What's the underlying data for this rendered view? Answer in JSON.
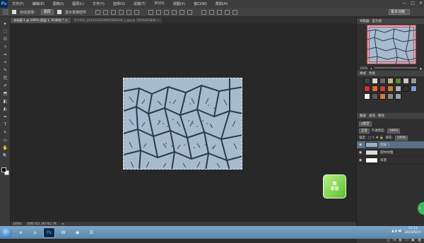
{
  "app": {
    "logo": "Ps"
  },
  "menu": [
    "文件(F)",
    "编辑(E)",
    "图像(I)",
    "图层(L)",
    "文字(Y)",
    "选择(S)",
    "滤镜(T)",
    "3D(D)",
    "视图(V)",
    "窗口(W)",
    "帮助(H)"
  ],
  "window_controls": {
    "min": "—",
    "max": "□",
    "close": "✕"
  },
  "options": {
    "auto_select_label": "自动选择：",
    "auto_select_value": "图层",
    "transform_label": "显示变换控件",
    "workspace": "基本功能"
  },
  "tabs": [
    {
      "label": "未标题-1 @ 100% (图层 1, RGB/8) *",
      "close": "×"
    },
    {
      "label": "551553_2014101024945084200_1.jpg @ 100%(RGB/8)",
      "close": "×"
    }
  ],
  "status": {
    "zoom": "100%",
    "doc": "文档:452.2K/702.7K",
    "arrow": "▸"
  },
  "panels": {
    "navigator_tabs": [
      "导航器",
      "直方图"
    ],
    "nav_zoom": "100%",
    "styles_tabs": [
      "样式",
      "色板"
    ],
    "layers_tabs": [
      "图层",
      "通道",
      "路径"
    ],
    "kind_label": "ρ类型",
    "blend_mode": "正常",
    "opacity_label": "不透明度:",
    "opacity_value": "100%",
    "lock_label": "锁定:",
    "fill_label": "填充:",
    "fill_value": "100%",
    "layers": [
      {
        "name": "图层 1",
        "selected": true
      },
      {
        "name": "裂纹纹理",
        "selected": false
      },
      {
        "name": "背景",
        "selected": false
      }
    ],
    "footer_icons": [
      "ⓖ",
      "fx",
      "◐",
      "▭",
      "▣",
      "🗑"
    ]
  },
  "float_logo": {
    "line1": "简",
    "line2": "单设"
  },
  "tools": [
    "▸",
    "⬚",
    "ʘ",
    "✧",
    "⌗",
    "⌖",
    "✎",
    "⎗",
    "✐",
    "⬒",
    "◧",
    "◐",
    "✒",
    "T",
    "↖",
    "▭",
    "✋",
    "🔍"
  ],
  "taskbar": {
    "apps": [
      "e",
      "⌂",
      "Ps",
      "W",
      "◉",
      "☰"
    ],
    "time": "13:11",
    "date": "2016/5/15"
  },
  "colors": {
    "style_swatches": [
      "#444",
      "#d8d8d8",
      "#6a6a6a",
      "#c8b48a",
      "#5a8b3a",
      "#c7c7c7",
      "#9a9a9a",
      "#d03030",
      "#e06b2b",
      "#c04040",
      "#d27a2a",
      "#b0b0b0",
      "#303030",
      "#7c9bd2",
      "#f0f0f0",
      "#5e5e5e",
      "#d87a3b",
      "#8a8a8a",
      "#a0a0a0"
    ],
    "layer_thumbs": [
      "#9bb0c6",
      "#dadada",
      "#ffffff"
    ]
  }
}
